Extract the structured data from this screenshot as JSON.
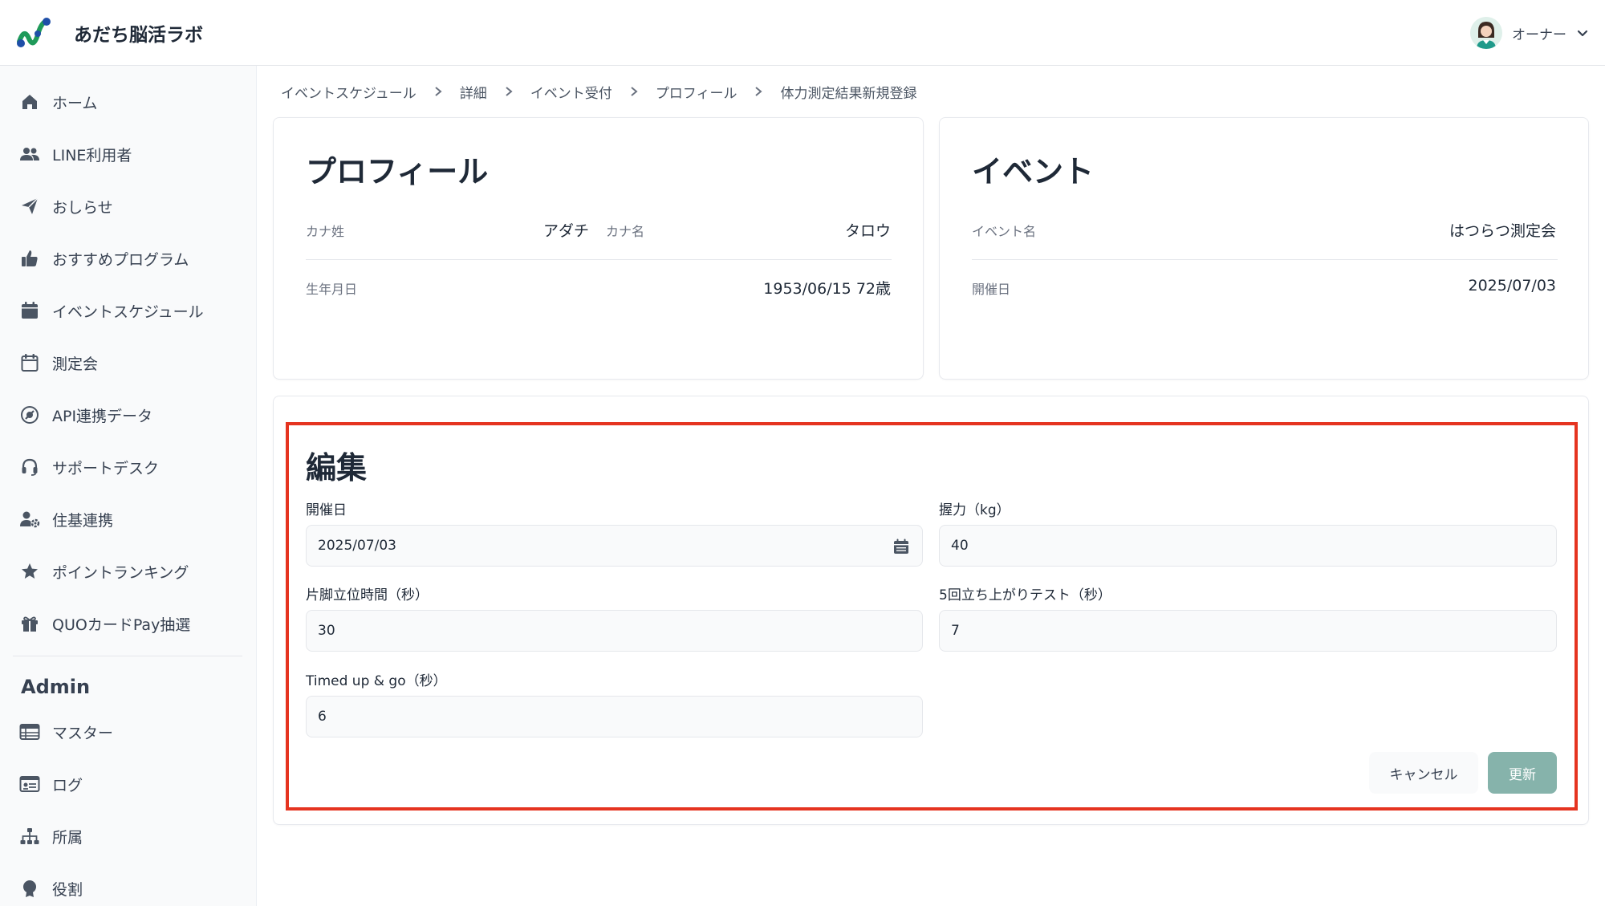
{
  "app": {
    "title": "あだち脳活ラボ"
  },
  "user": {
    "name": "オーナー"
  },
  "sidebar": {
    "items": [
      {
        "label": "ホーム",
        "icon": "home-icon"
      },
      {
        "label": "LINE利用者",
        "icon": "users-icon"
      },
      {
        "label": "おしらせ",
        "icon": "paper-plane-icon"
      },
      {
        "label": "おすすめプログラム",
        "icon": "thumbs-up-icon"
      },
      {
        "label": "イベントスケジュール",
        "icon": "calendar-icon"
      },
      {
        "label": "測定会",
        "icon": "calendar-outline-icon"
      },
      {
        "label": "API連携データ",
        "icon": "api-icon"
      },
      {
        "label": "サポートデスク",
        "icon": "headset-icon"
      },
      {
        "label": "住基連携",
        "icon": "user-gear-icon"
      },
      {
        "label": "ポイントランキング",
        "icon": "star-icon"
      },
      {
        "label": "QUOカードPay抽選",
        "icon": "gift-icon"
      }
    ],
    "admin_heading": "Admin",
    "admin_items": [
      {
        "label": "マスター",
        "icon": "table-icon"
      },
      {
        "label": "ログ",
        "icon": "log-icon"
      },
      {
        "label": "所属",
        "icon": "org-chart-icon"
      },
      {
        "label": "役割",
        "icon": "badge-icon"
      }
    ]
  },
  "breadcrumb": [
    "イベントスケジュール",
    "詳細",
    "イベント受付",
    "プロフィール",
    "体力測定結果新規登録"
  ],
  "profile": {
    "title": "プロフィール",
    "kana_last_label": "カナ姓",
    "kana_last_value": "アダチ",
    "kana_first_label": "カナ名",
    "kana_first_value": "タロウ",
    "birth_label": "生年月日",
    "birth_value": "1953/06/15 72歳"
  },
  "event": {
    "title": "イベント",
    "name_label": "イベント名",
    "name_value": "はつらつ測定会",
    "date_label": "開催日",
    "date_value": "2025/07/03"
  },
  "form": {
    "title": "編集",
    "date_label": "開催日",
    "date_value": "2025/07/03",
    "grip_label": "握力（kg）",
    "grip_value": "40",
    "one_leg_label": "片脚立位時間（秒）",
    "one_leg_value": "30",
    "sit_stand_label": "5回立ち上がりテスト（秒）",
    "sit_stand_value": "7",
    "tug_label": "Timed up & go（秒）",
    "tug_value": "6",
    "cancel_label": "キャンセル",
    "update_label": "更新"
  },
  "colors": {
    "accent": "#86b3ab",
    "highlight": "#e53420",
    "logo_green": "#1f9a5a",
    "logo_blue": "#1f4fa8"
  }
}
